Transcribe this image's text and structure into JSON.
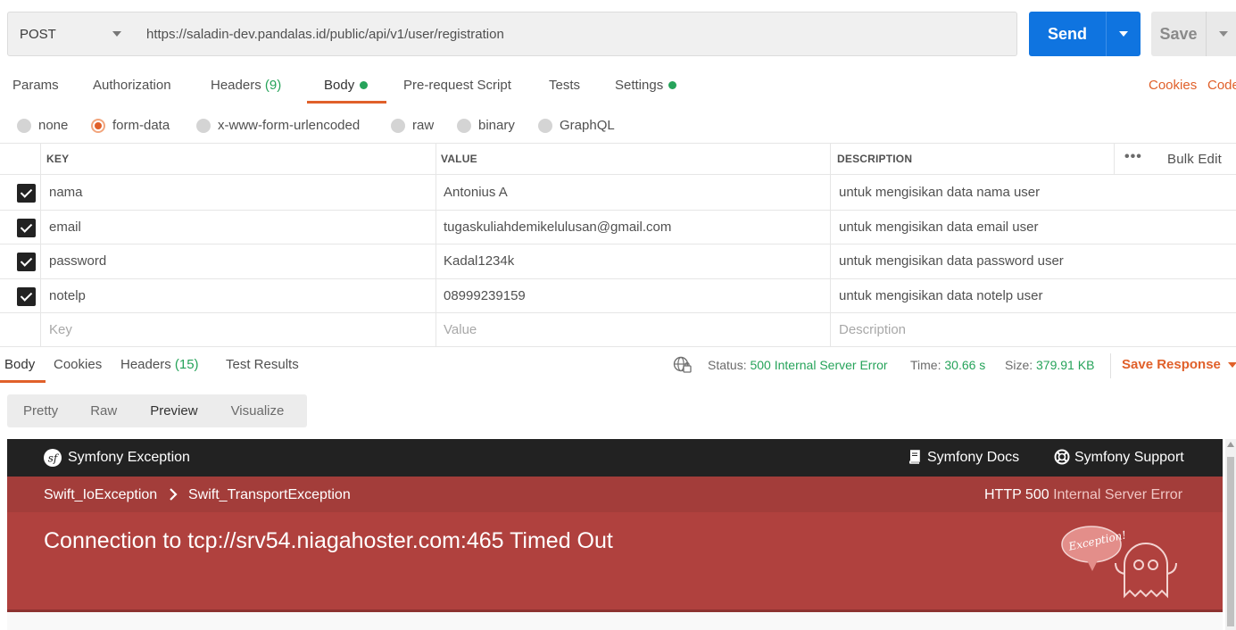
{
  "request": {
    "method": "POST",
    "url": "https://saladin-dev.pandalas.id/public/api/v1/user/registration",
    "send_label": "Send",
    "save_label": "Save"
  },
  "tabs": {
    "params": "Params",
    "authorization": "Authorization",
    "headers_label": "Headers",
    "headers_count": "(9)",
    "body": "Body",
    "prerequest": "Pre-request Script",
    "tests": "Tests",
    "settings": "Settings",
    "cookies": "Cookies",
    "code": "Code"
  },
  "body_types": {
    "none": "none",
    "form_data": "form-data",
    "urlencoded": "x-www-form-urlencoded",
    "raw": "raw",
    "binary": "binary",
    "graphql": "GraphQL",
    "selected": "form-data"
  },
  "table": {
    "headers": {
      "key": "KEY",
      "value": "VALUE",
      "description": "DESCRIPTION"
    },
    "bulk_edit": "Bulk Edit",
    "more": "•••",
    "rows": [
      {
        "key": "nama",
        "value": "Antonius A",
        "description": "untuk mengisikan data nama user"
      },
      {
        "key": "email",
        "value": "tugaskuliahdemikelulusan@gmail.com",
        "description": "untuk mengisikan data email user"
      },
      {
        "key": "password",
        "value": "Kadal1234k",
        "description": "untuk mengisikan data password user"
      },
      {
        "key": "notelp",
        "value": "08999239159",
        "description": "untuk mengisikan data notelp user"
      }
    ],
    "placeholder": {
      "key": "Key",
      "value": "Value",
      "description": "Description"
    }
  },
  "response": {
    "tabs": {
      "body": "Body",
      "cookies": "Cookies",
      "headers_label": "Headers",
      "headers_count": "(15)",
      "test_results": "Test Results"
    },
    "status_label": "Status:",
    "status_value": "500 Internal Server Error",
    "time_label": "Time:",
    "time_value": "30.66 s",
    "size_label": "Size:",
    "size_value": "379.91 KB",
    "save_response": "Save Response",
    "views": {
      "pretty": "Pretty",
      "raw": "Raw",
      "preview": "Preview",
      "visualize": "Visualize"
    }
  },
  "symfony": {
    "title": "Symfony Exception",
    "docs": "Symfony Docs",
    "support": "Symfony Support",
    "breadcrumb_1": "Swift_IoException",
    "breadcrumb_2": "Swift_TransportException",
    "http_code": "HTTP 500",
    "http_text": "Internal Server Error",
    "message": "Connection to tcp://srv54.niagahoster.com:465 Timed Out",
    "badge": "Exception!"
  },
  "colors": {
    "accent": "#e0602a",
    "send_blue": "#0f74e0",
    "success_green": "#26a35a",
    "symfony_red": "#b0413e",
    "symfony_dark": "#222222"
  }
}
